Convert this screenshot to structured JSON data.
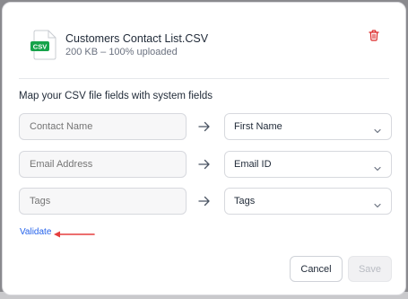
{
  "file": {
    "icon_label": "CSV",
    "name": "Customers Contact List.CSV",
    "meta": "200 KB – 100% uploaded"
  },
  "mapping": {
    "title": "Map your CSV file fields with system fields",
    "rows": [
      {
        "source_placeholder": "Contact Name",
        "target": "First Name"
      },
      {
        "source_placeholder": "Email Address",
        "target": "Email ID"
      },
      {
        "source_placeholder": "Tags",
        "target": "Tags"
      }
    ]
  },
  "actions": {
    "validate": "Validate",
    "cancel": "Cancel",
    "save": "Save"
  },
  "colors": {
    "csv_badge": "#16a34a",
    "delete_icon": "#dc2626",
    "link": "#2563eb",
    "annotation_arrow": "#e53e3e"
  },
  "icons": [
    "csv-file-icon",
    "trash-icon",
    "arrow-right-icon",
    "chevron-down-icon"
  ]
}
